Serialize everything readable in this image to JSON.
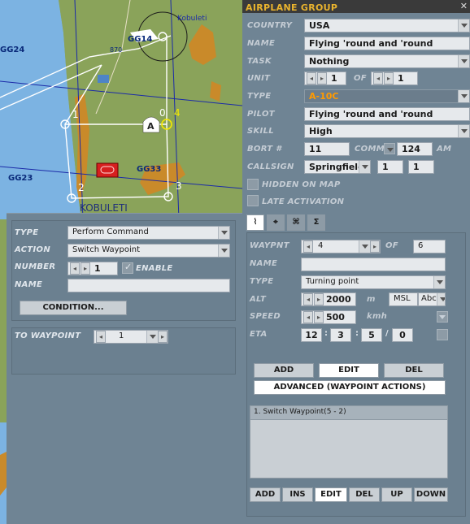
{
  "map": {
    "labels": [
      "Kobuleti",
      "GG14",
      "GG24",
      "GG23",
      "GG33",
      "KOBULETI",
      "870",
      "1",
      "0",
      "4",
      "2",
      "3",
      "A"
    ]
  },
  "airplane_group": {
    "title": "AIRPLANE GROUP",
    "close": "✕",
    "country_label": "COUNTRY",
    "country": "USA",
    "name_label": "NAME",
    "name": "Flying 'round and 'round",
    "task_label": "TASK",
    "task": "Nothing",
    "unit_label": "UNIT",
    "unit": "1",
    "of_label": "OF",
    "unit_of": "1",
    "type_label": "TYPE",
    "type": "A-10C",
    "pilot_label": "PILOT",
    "pilot": "Flying 'round and 'round",
    "skill_label": "SKILL",
    "skill": "High",
    "bort_label": "BORT #",
    "bort": "11",
    "comm_label": "COMM",
    "comm": "124",
    "comm_unit": "AM",
    "callsign_label": "CALLSIGN",
    "callsign": "Springfield",
    "callsign_num1": "1",
    "callsign_num2": "1",
    "hidden_label": "HIDDEN ON MAP",
    "late_label": "LATE ACTIVATION",
    "tabs": [
      "route-icon",
      "target-icon",
      "payload-icon",
      "summary-icon"
    ],
    "tab_glyphs": [
      "⌇",
      "⌖",
      "⌘",
      "Σ"
    ]
  },
  "waypoint": {
    "waypnt_label": "WAYPNT",
    "waypnt": "4",
    "of_label": "OF",
    "of_value": "6",
    "name_label": "NAME",
    "name": "",
    "type_label": "TYPE",
    "type": "Turning point",
    "alt_label": "ALT",
    "alt": "2000",
    "alt_unit": "m",
    "alt_ref": "MSL",
    "alt_mode": "Abc",
    "speed_label": "SPEED",
    "speed": "500",
    "speed_unit": "kmh",
    "eta_label": "ETA",
    "eta_h": "12",
    "eta_m": "3",
    "eta_s": "5",
    "eta_d": "0",
    "buttons": [
      "ADD",
      "EDIT",
      "DEL"
    ],
    "advanced_label": "ADVANCED (WAYPOINT ACTIONS)",
    "actions": [
      "1. Switch Waypoint(5 - 2)"
    ],
    "action_buttons": [
      "ADD",
      "INS",
      "EDIT",
      "DEL",
      "UP",
      "DOWN"
    ]
  },
  "command": {
    "type_label": "TYPE",
    "type": "Perform Command",
    "action_label": "ACTION",
    "action": "Switch Waypoint",
    "number_label": "NUMBER",
    "number": "1",
    "enable_label": "ENABLE",
    "name_label": "NAME",
    "name": "",
    "condition_label": "CONDITION...",
    "to_waypoint_label": "TO WAYPOINT",
    "to_waypoint": "1"
  },
  "colors": {
    "panel": "#6f8494",
    "title_bar": "#3a3a3a",
    "accent": "#e9b32e",
    "orange_text": "#ff9a00"
  }
}
